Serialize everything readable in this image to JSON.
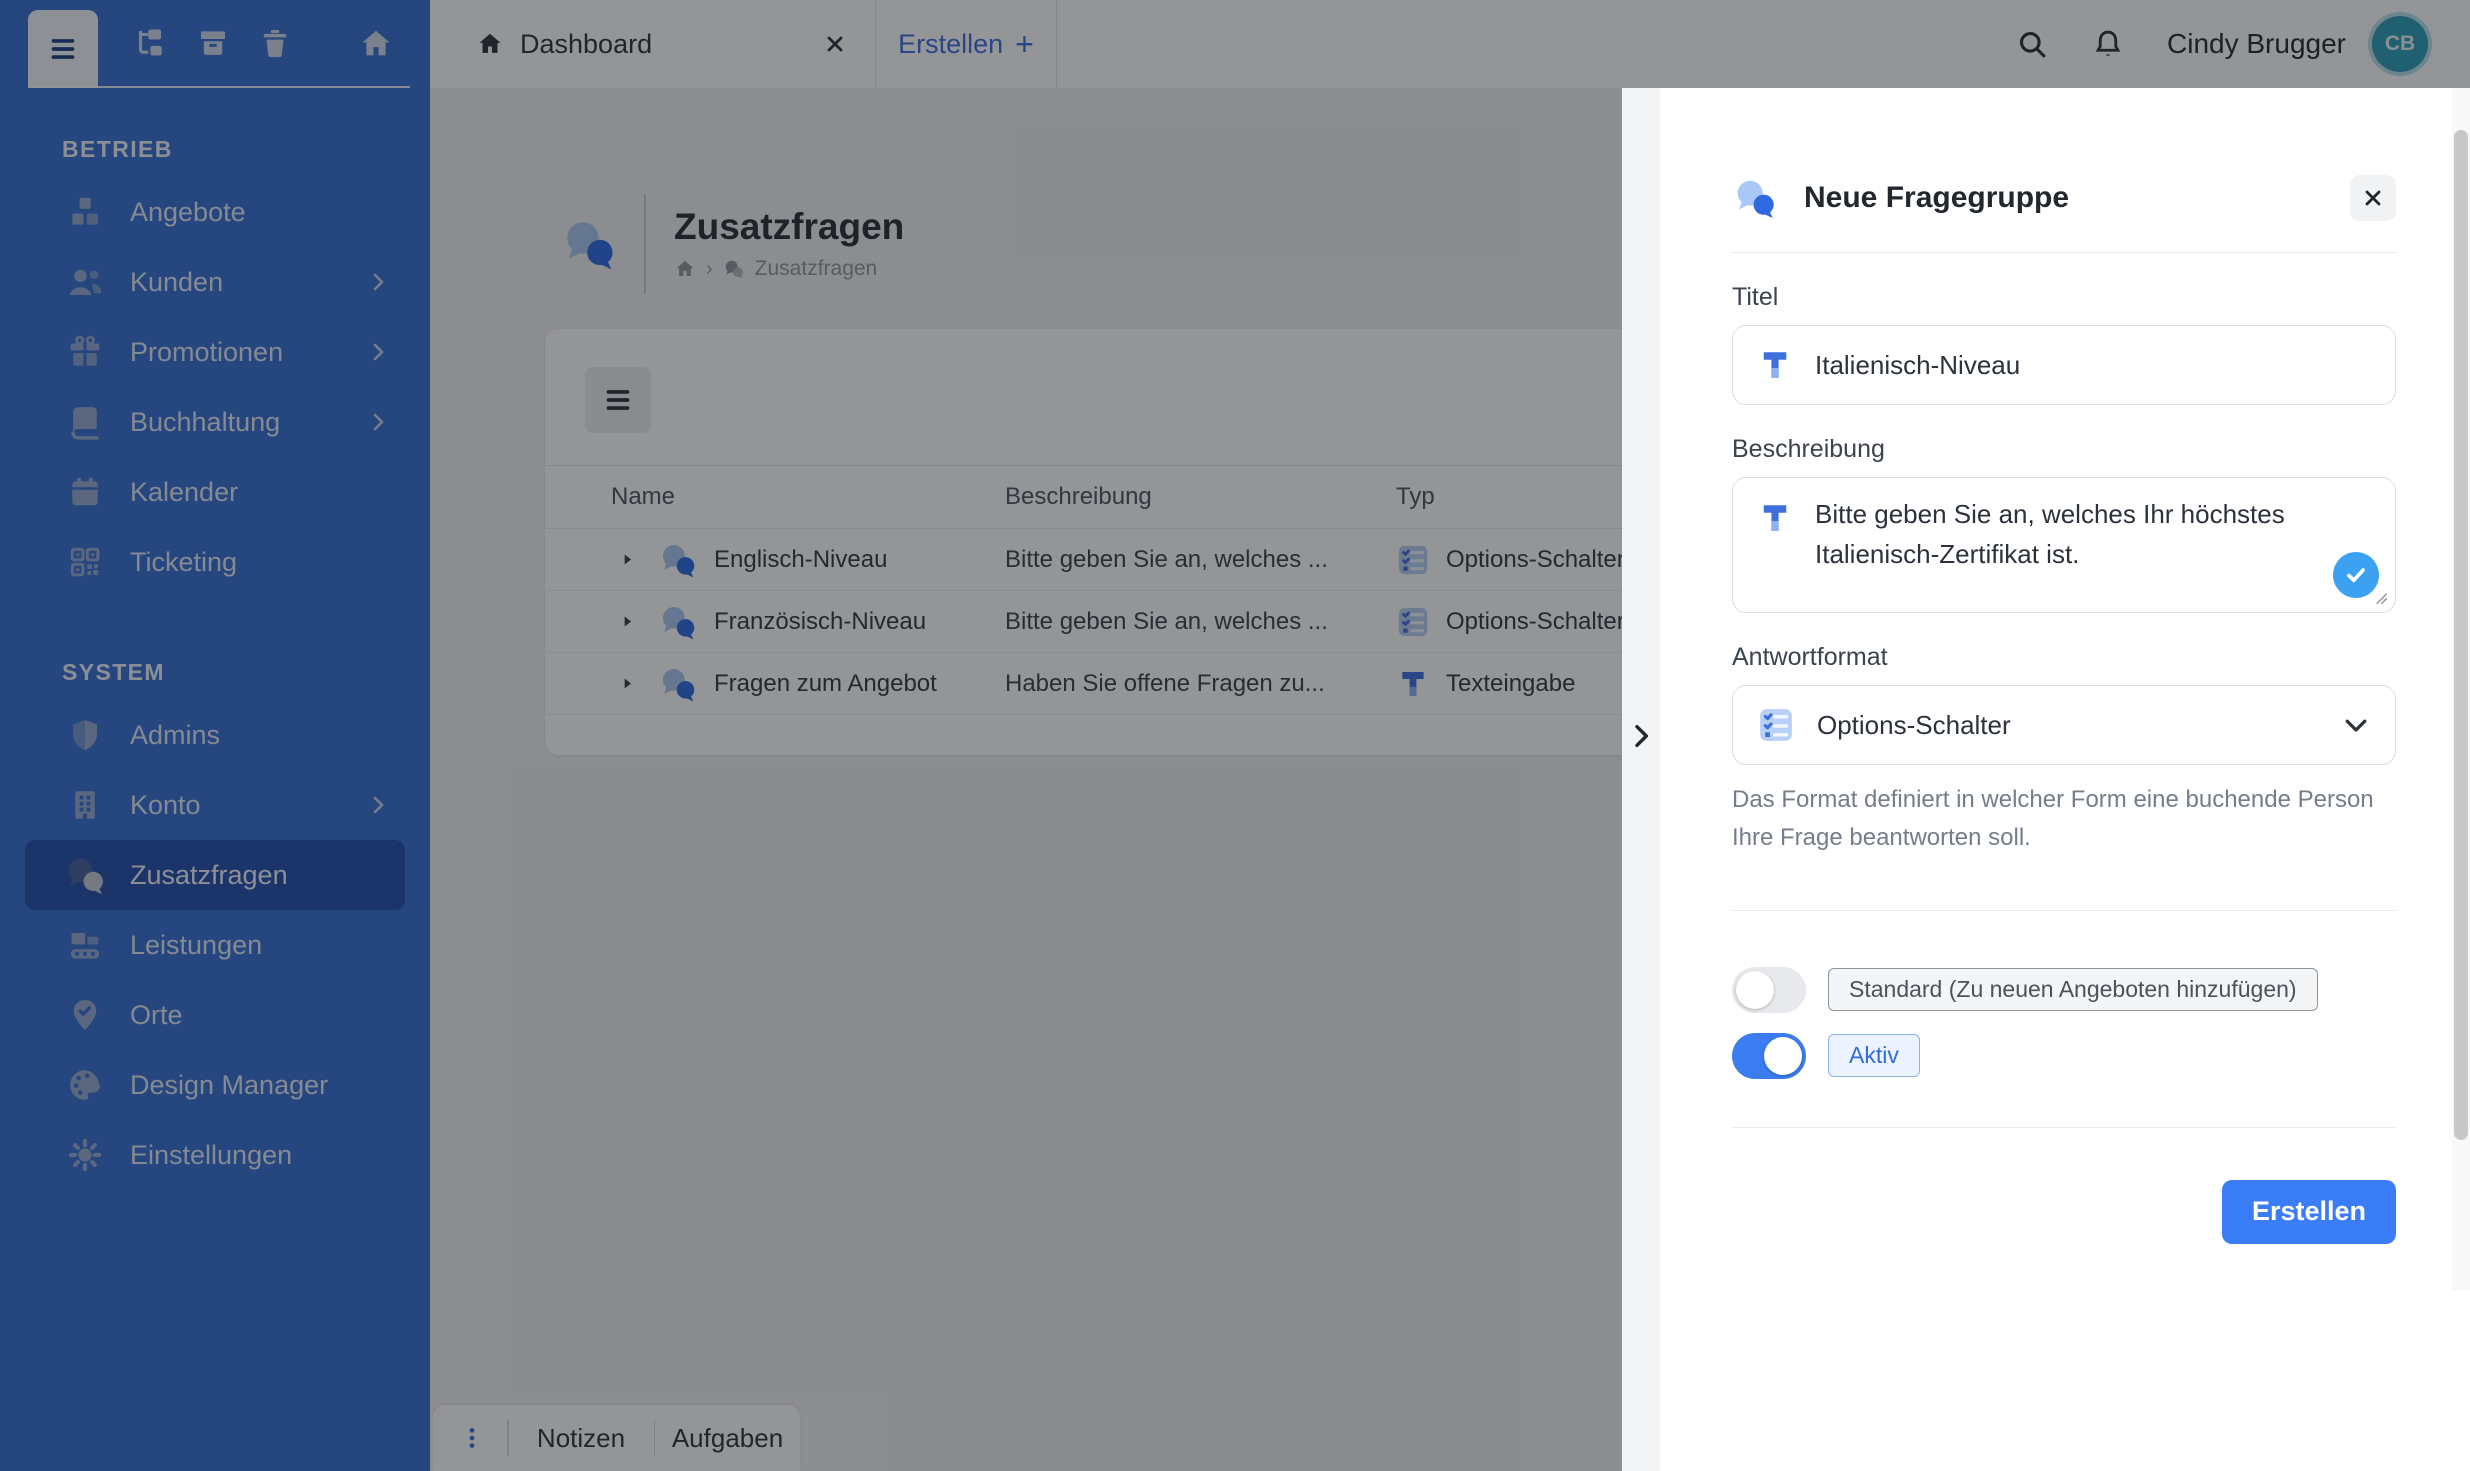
{
  "colors": {
    "accent": "#3b7cf7",
    "sidebar_bg": "#3570d4",
    "sidebar_active": "#2351af",
    "avatar_bg": "#2d9fba",
    "toggle_on": "#3b7cf0",
    "check_circle": "#3da1f2"
  },
  "sidebar": {
    "sections": [
      {
        "label": "BETRIEB",
        "items": [
          {
            "label": "Angebote",
            "icon": "cubes-icon",
            "chevron": false
          },
          {
            "label": "Kunden",
            "icon": "users-icon",
            "chevron": true
          },
          {
            "label": "Promotionen",
            "icon": "gift-icon",
            "chevron": true
          },
          {
            "label": "Buchhaltung",
            "icon": "book-icon",
            "chevron": true
          },
          {
            "label": "Kalender",
            "icon": "calendar-icon",
            "chevron": false
          },
          {
            "label": "Ticketing",
            "icon": "qr-icon",
            "chevron": false
          }
        ]
      },
      {
        "label": "SYSTEM",
        "items": [
          {
            "label": "Admins",
            "icon": "shield-icon",
            "chevron": false
          },
          {
            "label": "Konto",
            "icon": "building-icon",
            "chevron": true
          },
          {
            "label": "Zusatzfragen",
            "icon": "chat-bubbles-icon",
            "chevron": false,
            "active": true
          },
          {
            "label": "Leistungen",
            "icon": "conveyor-icon",
            "chevron": false
          },
          {
            "label": "Orte",
            "icon": "map-pin-icon",
            "chevron": false
          },
          {
            "label": "Design Manager",
            "icon": "palette-icon",
            "chevron": false
          },
          {
            "label": "Einstellungen",
            "icon": "gear-icon",
            "chevron": false
          }
        ]
      }
    ]
  },
  "topbar": {
    "tabs": [
      {
        "label": "Dashboard",
        "closable": true
      },
      {
        "label": "Erstellen",
        "plus": "+"
      }
    ],
    "user_name": "Cindy Brugger",
    "user_initials": "CB"
  },
  "page": {
    "title": "Zusatzfragen",
    "breadcrumb_sep": "›",
    "breadcrumb_current": "Zusatzfragen"
  },
  "table": {
    "columns": [
      "Name",
      "Beschreibung",
      "Typ"
    ],
    "rows": [
      {
        "name": "Englisch-Niveau",
        "description": "Bitte geben Sie an, welches ...",
        "type": "Options-Schalter",
        "type_icon": "options-list-icon"
      },
      {
        "name": "Französisch-Niveau",
        "description": "Bitte geben Sie an, welches ...",
        "type": "Options-Schalter",
        "type_icon": "options-list-icon"
      },
      {
        "name": "Fragen zum Angebot",
        "description": "Haben Sie offene Fragen zu...",
        "type": "Texteingabe",
        "type_icon": "text-input-icon"
      }
    ]
  },
  "bottombar": {
    "items": [
      "Notizen",
      "Aufgaben"
    ]
  },
  "drawer": {
    "title": "Neue Fragegruppe",
    "titel_label": "Titel",
    "titel_value": "Italienisch-Niveau",
    "beschreibung_label": "Beschreibung",
    "beschreibung_value": "Bitte geben Sie an, welches Ihr höchstes Italienisch-Zertifikat ist.",
    "antwortformat_label": "Antwortformat",
    "antwortformat_value": "Options-Schalter",
    "antwortformat_help": "Das Format definiert in welcher Form eine buchende Person Ihre Frage beantworten soll.",
    "toggle_standard_label": "Standard (Zu neuen Angeboten hinzufügen)",
    "toggle_aktiv_label": "Aktiv",
    "submit_label": "Erstellen"
  }
}
